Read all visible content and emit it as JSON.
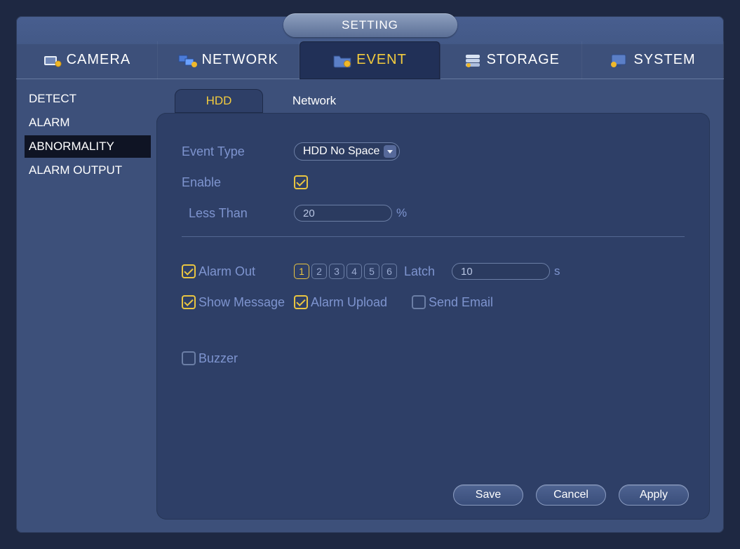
{
  "title": "SETTING",
  "mainnav": [
    {
      "id": "camera",
      "label": "CAMERA"
    },
    {
      "id": "network",
      "label": "NETWORK"
    },
    {
      "id": "event",
      "label": "EVENT"
    },
    {
      "id": "storage",
      "label": "STORAGE"
    },
    {
      "id": "system",
      "label": "SYSTEM"
    }
  ],
  "mainnav_active": "event",
  "sidebar": {
    "items": [
      "DETECT",
      "ALARM",
      "ABNORMALITY",
      "ALARM OUTPUT"
    ],
    "active_index": 2
  },
  "subtabs": {
    "items": [
      "HDD",
      "Network"
    ],
    "active_index": 0
  },
  "form": {
    "eventTypeLabel": "Event Type",
    "eventTypeValue": "HDD No Space",
    "enableLabel": "Enable",
    "enableChecked": true,
    "lessThanLabel": "Less Than",
    "lessThanValue": "20",
    "lessThanUnit": "%",
    "alarmOut": {
      "label": "Alarm Out",
      "checked": true
    },
    "channels": [
      {
        "n": "1",
        "on": true
      },
      {
        "n": "2",
        "on": false
      },
      {
        "n": "3",
        "on": false
      },
      {
        "n": "4",
        "on": false
      },
      {
        "n": "5",
        "on": false
      },
      {
        "n": "6",
        "on": false
      }
    ],
    "latchLabel": "Latch",
    "latchValue": "10",
    "latchUnit": "s",
    "showMessage": {
      "label": "Show Message",
      "checked": true
    },
    "alarmUpload": {
      "label": "Alarm Upload",
      "checked": true
    },
    "sendEmail": {
      "label": "Send Email",
      "checked": false
    },
    "buzzer": {
      "label": "Buzzer",
      "checked": false
    }
  },
  "buttons": {
    "save": "Save",
    "cancel": "Cancel",
    "apply": "Apply"
  }
}
